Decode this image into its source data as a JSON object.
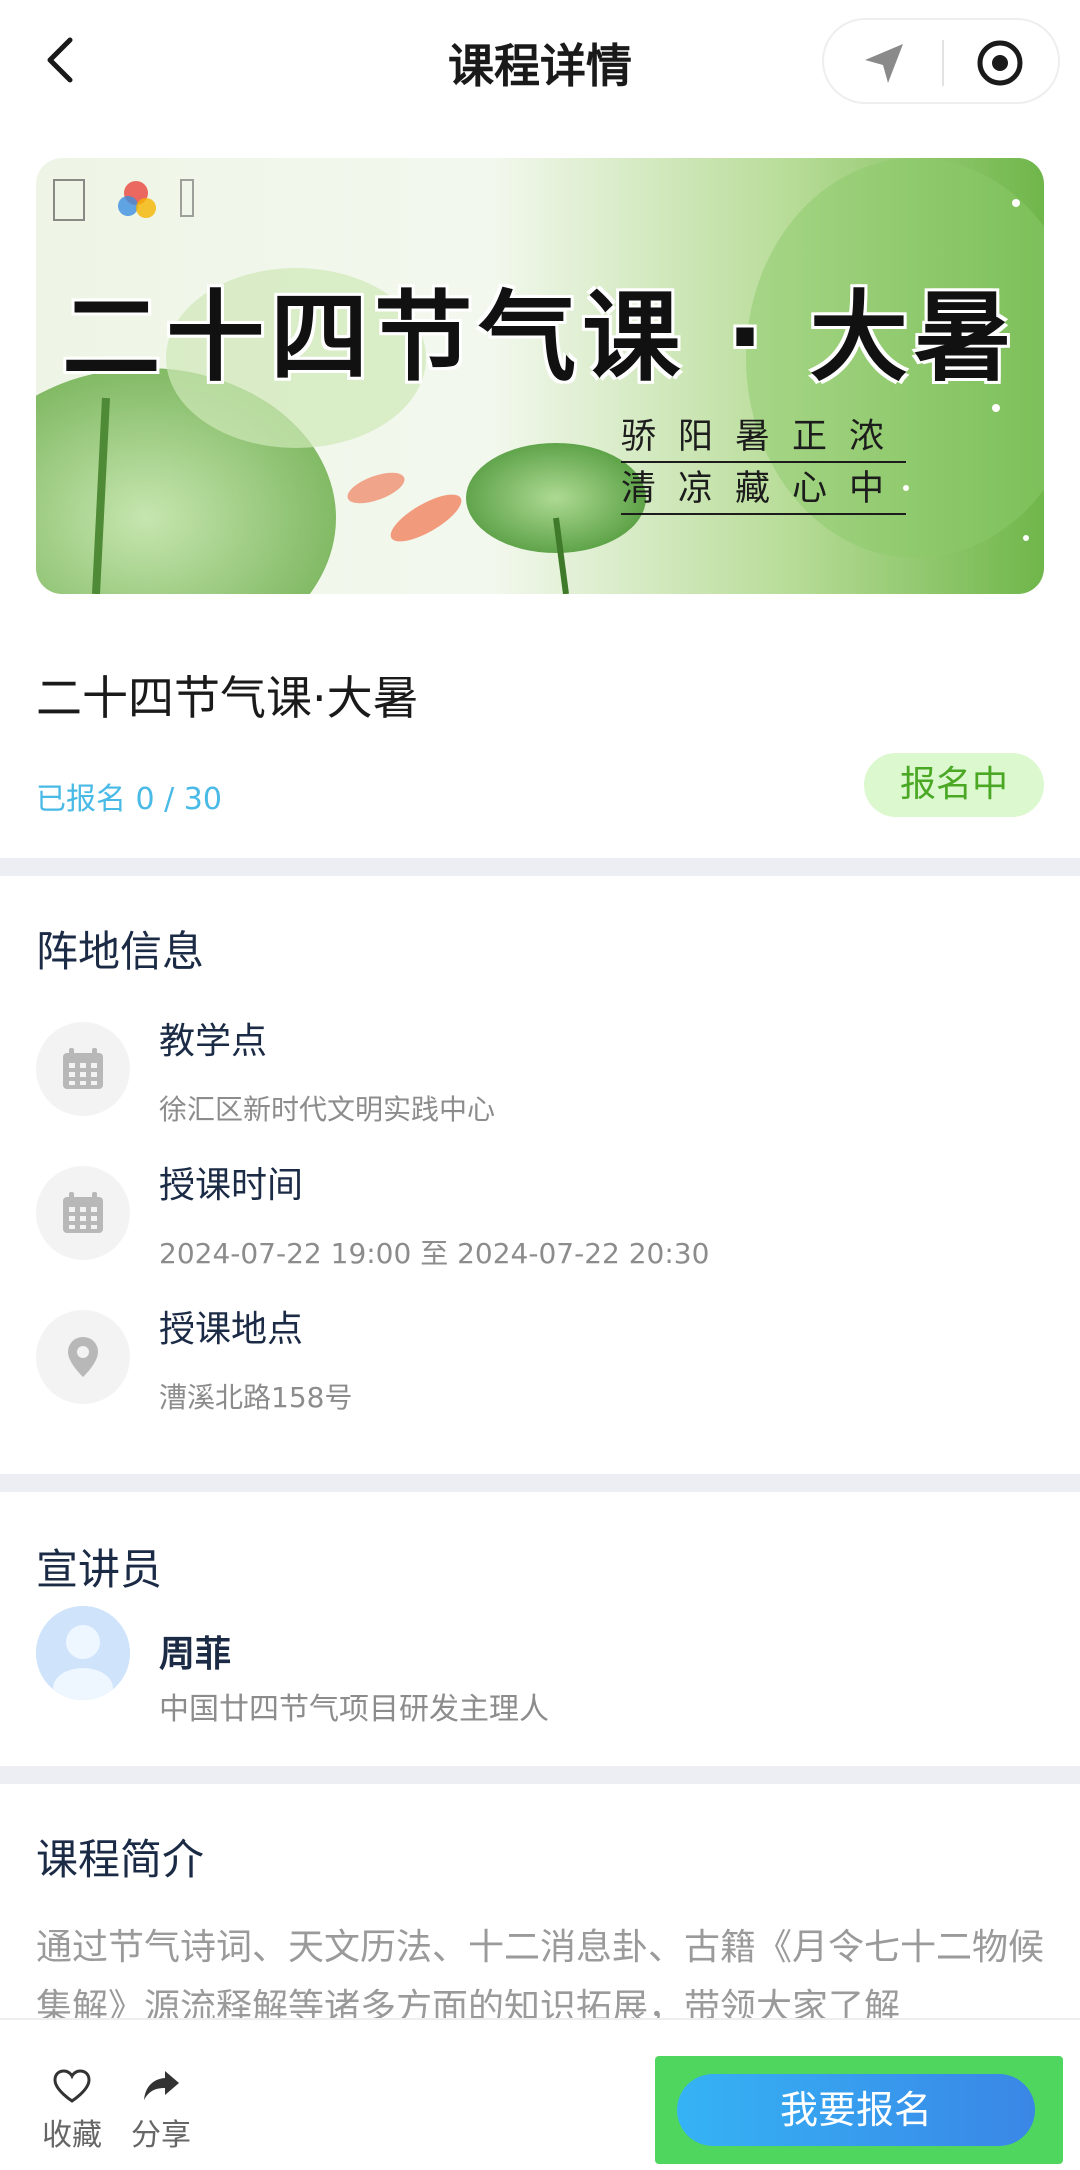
{
  "header": {
    "title": "课程详情",
    "back_icon": "chevron-left-icon",
    "capsule_icons": [
      "location-arrow-icon",
      "target-icon"
    ]
  },
  "banner": {
    "title": "二十四节气课 · 大暑",
    "poem_line1": "骄阳暑正浓",
    "poem_line2": "清凉藏心中"
  },
  "course": {
    "title": "二十四节气课·大暑",
    "enrolled": "已报名 0 / 30",
    "status": "报名中"
  },
  "venue": {
    "section_title": "阵地信息",
    "items": [
      {
        "label": "教学点",
        "value": "徐汇区新时代文明实践中心",
        "icon": "calendar-icon"
      },
      {
        "label": "授课时间",
        "value": "2024-07-22 19:00 至 2024-07-22 20:30",
        "icon": "calendar-icon"
      },
      {
        "label": "授课地点",
        "value": "漕溪北路158号",
        "icon": "location-pin-icon"
      }
    ]
  },
  "speaker": {
    "section_title": "宣讲员",
    "name": "周菲",
    "title": "中国廿四节气项目研发主理人"
  },
  "intro": {
    "section_title": "课程简介",
    "text": "通过节气诗词、天文历法、十二消息卦、古籍《月令七十二物候集解》源流释解等诸多方面的知识拓展，带领大家了解"
  },
  "bottom_bar": {
    "favorite_label": "收藏",
    "share_label": "分享",
    "signup_label": "我要报名"
  },
  "colors": {
    "accent_blue": "#49b9e6",
    "status_green": "#4aa825",
    "status_bg": "#dcf8cf",
    "separator": "#eceef3",
    "signup_highlight": "#4fd65f"
  }
}
